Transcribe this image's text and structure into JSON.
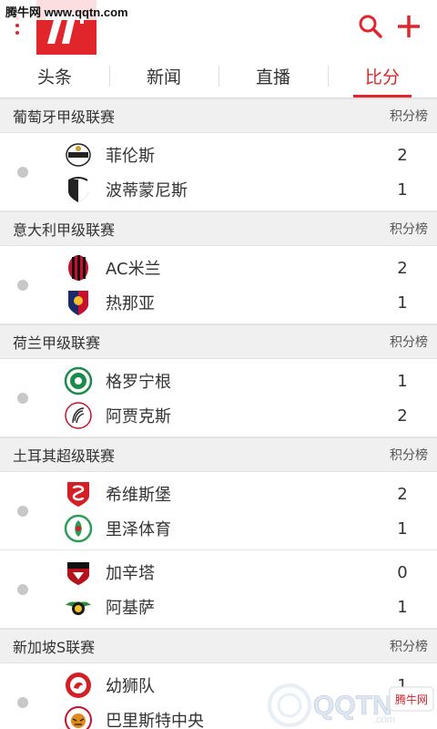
{
  "watermark_top": "腾牛网 www.qqtn.com",
  "tabs": [
    {
      "label": "头条",
      "active": false
    },
    {
      "label": "新闻",
      "active": false
    },
    {
      "label": "直播",
      "active": false
    },
    {
      "label": "比分",
      "active": true
    }
  ],
  "standings_label": "积分榜",
  "leagues": [
    {
      "name": "葡萄牙甲级联赛",
      "show_standings": true,
      "matches": [
        {
          "home": "菲伦斯",
          "home_score": "2",
          "away": "波蒂蒙尼斯",
          "away_score": "1"
        }
      ]
    },
    {
      "name": "意大利甲级联赛",
      "show_standings": true,
      "matches": [
        {
          "home": "AC米兰",
          "home_score": "2",
          "away": "热那亚",
          "away_score": "1"
        }
      ]
    },
    {
      "name": "荷兰甲级联赛",
      "show_standings": true,
      "matches": [
        {
          "home": "格罗宁根",
          "home_score": "1",
          "away": "阿贾克斯",
          "away_score": "2"
        }
      ]
    },
    {
      "name": "土耳其超级联赛",
      "show_standings": true,
      "matches": [
        {
          "home": "希维斯堡",
          "home_score": "2",
          "away": "里泽体育",
          "away_score": "1"
        },
        {
          "home": "加辛塔",
          "home_score": "0",
          "away": "阿基萨",
          "away_score": "1"
        }
      ]
    },
    {
      "name": "新加坡S联赛",
      "show_standings": true,
      "matches": [
        {
          "home": "幼狮队",
          "home_score": "1",
          "away": "巴里斯特中央",
          "away_score": ""
        }
      ]
    }
  ],
  "watermark_bottom": {
    "brand": "QQTN",
    "suffix": ".com",
    "badge": "腾牛网"
  },
  "colors": {
    "accent": "#e0262b",
    "header_bg": "#f0f0f0",
    "dot": "#c8c8c8"
  }
}
